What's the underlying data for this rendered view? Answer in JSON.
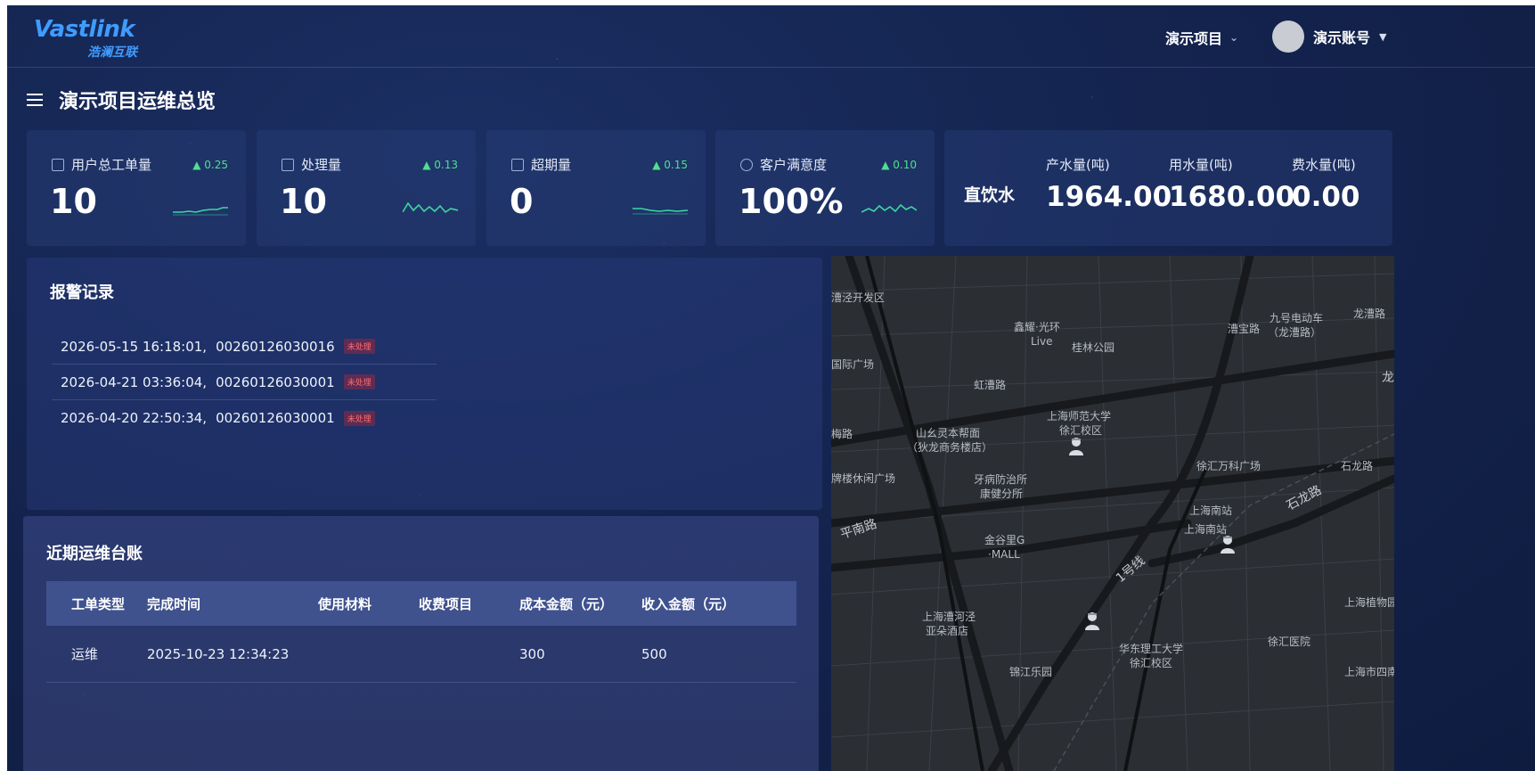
{
  "brand": {
    "logo_main": "Vastlink",
    "logo_sub": "浩澜互联",
    "accent": "#3f9cff"
  },
  "header": {
    "project": "演示项目",
    "account": "演示账号"
  },
  "page": {
    "title": "演示项目运维总览"
  },
  "kpis": [
    {
      "label": "用户总工单量",
      "trend": "0.25",
      "value": "10",
      "icon": "workorder-icon"
    },
    {
      "label": "处理量",
      "trend": "0.13",
      "value": "10",
      "icon": "check-icon"
    },
    {
      "label": "超期量",
      "trend": "0.15",
      "value": "0",
      "icon": "clipboard-icon"
    },
    {
      "label": "客户满意度",
      "trend": "0.10",
      "value": "100%",
      "icon": "smile-icon"
    }
  ],
  "water": {
    "title": "直饮水",
    "metrics": [
      {
        "label": "产水量(吨)",
        "value": "1964.00"
      },
      {
        "label": "用水量(吨)",
        "value": "1680.00"
      },
      {
        "label": "费水量(吨)",
        "value": "0.00"
      }
    ]
  },
  "alarms": {
    "title": "报警记录",
    "items": [
      {
        "time": "2026-05-15 16:18:01,",
        "code": "00260126030016",
        "status": "未处理"
      },
      {
        "time": "2026-04-21 03:36:04,",
        "code": "00260126030001",
        "status": "未处理"
      },
      {
        "time": "2026-04-20 22:50:34,",
        "code": "00260126030001",
        "status": "未处理"
      }
    ]
  },
  "ledger": {
    "title": "近期运维台账",
    "columns": [
      "工单类型",
      "完成时间",
      "使用材料",
      "收费项目",
      "成本金额（元）",
      "收入金额（元）"
    ],
    "rows": [
      [
        "运维",
        "2025-10-23 12:34:23",
        "",
        "",
        "300",
        "500"
      ]
    ]
  },
  "map": {
    "labels": {
      "a": "漕泾开发区",
      "b": "鑫耀·光环",
      "c": "Live",
      "d": "桂林公园",
      "e": "漕宝路",
      "f": "九号电动车",
      "g": "（龙漕路）",
      "h": "龙漕路",
      "i": "国际广场",
      "j": "虹漕路",
      "k": "上海师范大学",
      "l": "徐汇校区",
      "m": "梅路",
      "n": "山幺灵本帮面",
      "o": "（狄龙商务楼店）",
      "p": "牌楼休闲广场",
      "q": "牙病防治所",
      "r": "康健分所",
      "s": "徐汇万科广场",
      "t": "石龙路",
      "u": "平南路",
      "v": "上海南站",
      "w": "上海南站",
      "x": "石龙路",
      "y": "金谷里G",
      "z": "·MALL",
      "aa": "1号线",
      "ab": "上海漕河泾",
      "ac": "亚朵酒店",
      "ad": "华东理工大学",
      "ae": "徐汇校区",
      "af": "徐汇医院",
      "ag": "上海植物园",
      "ah": "锦江乐园",
      "ai": "上海市四南",
      "aj": "龙"
    }
  }
}
